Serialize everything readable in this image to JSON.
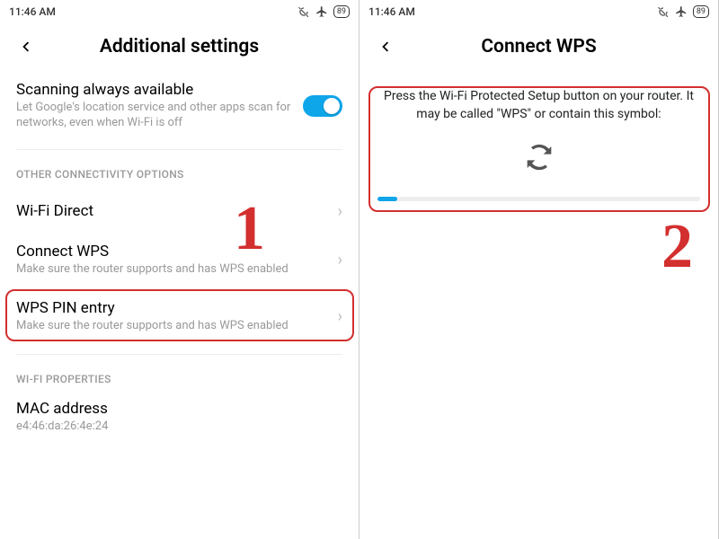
{
  "status": {
    "time": "11:46 AM",
    "battery": "89"
  },
  "screen1": {
    "title": "Additional settings",
    "scanning": {
      "title": "Scanning always available",
      "sub": "Let Google's location service and other apps scan for networks, even when Wi-Fi is off"
    },
    "sectionOther": "OTHER CONNECTIVITY OPTIONS",
    "wifiDirect": "Wi-Fi Direct",
    "connectWps": {
      "title": "Connect WPS",
      "sub": "Make sure the router supports and has WPS enabled"
    },
    "wpsPin": {
      "title": "WPS PIN entry",
      "sub": "Make sure the router supports and has WPS enabled"
    },
    "sectionWifiProps": "WI-FI PROPERTIES",
    "mac": {
      "title": "MAC address",
      "sub": "e4:46:da:26:4e:24"
    }
  },
  "screen2": {
    "title": "Connect WPS",
    "instruction": "Press the Wi-Fi Protected Setup button on your router. It may be called \"WPS\" or contain this symbol:"
  },
  "annotations": {
    "step1": "1",
    "step2": "2"
  }
}
